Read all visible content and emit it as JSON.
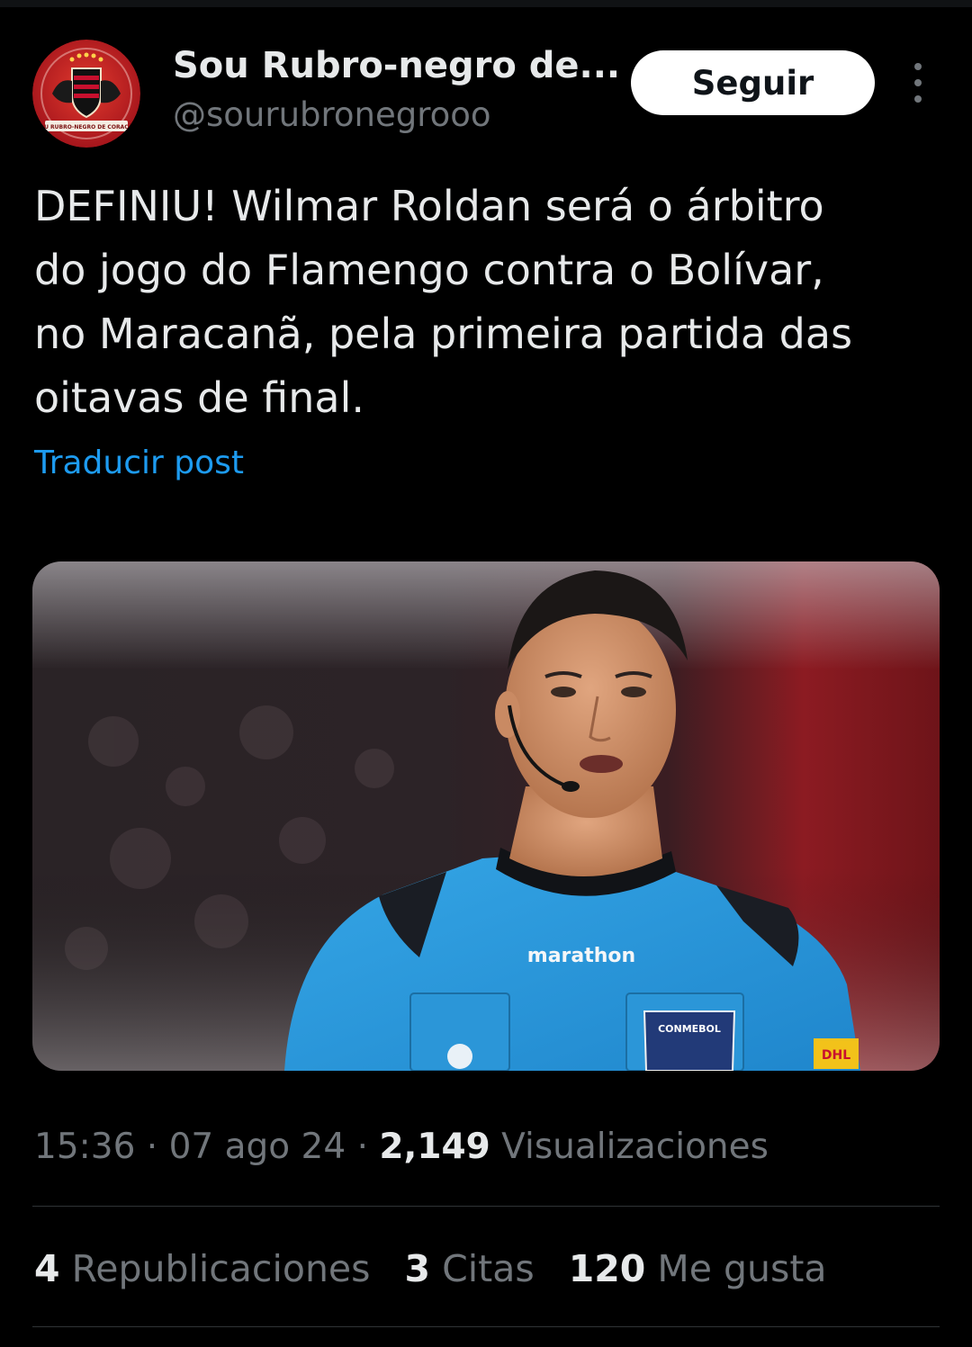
{
  "author": {
    "display_name": "Sou Rubro-negro de...",
    "handle": "@sourubronegrooo",
    "avatar_banner_text": "SOU RUBRO-NEGRO DE CORAÇÃO"
  },
  "follow_label": "Seguir",
  "post": {
    "text": "DEFINIU! Wilmar Roldan será o árbitro\ndo jogo do Flamengo contra o Bolívar,\nno Maracanã, pela primeira partida das\noitavas de final.",
    "translate_label": "Traducir post"
  },
  "photo": {
    "shirt_brand": "marathon",
    "badge_text": "CONMEBOL",
    "sponsor_text": "DHL"
  },
  "meta": {
    "time": "15:36",
    "separator": " · ",
    "date": "07 ago 24",
    "views_count": "2,149",
    "views_label": "Visualizaciones"
  },
  "stats": {
    "reposts_count": "4",
    "reposts_label": "Republicaciones",
    "quotes_count": "3",
    "quotes_label": "Citas",
    "likes_count": "120",
    "likes_label": "Me gusta"
  },
  "colors": {
    "background": "#000000",
    "link": "#1d9bf0",
    "secondary_text": "#71767b",
    "primary_text": "#e7e9ea"
  }
}
